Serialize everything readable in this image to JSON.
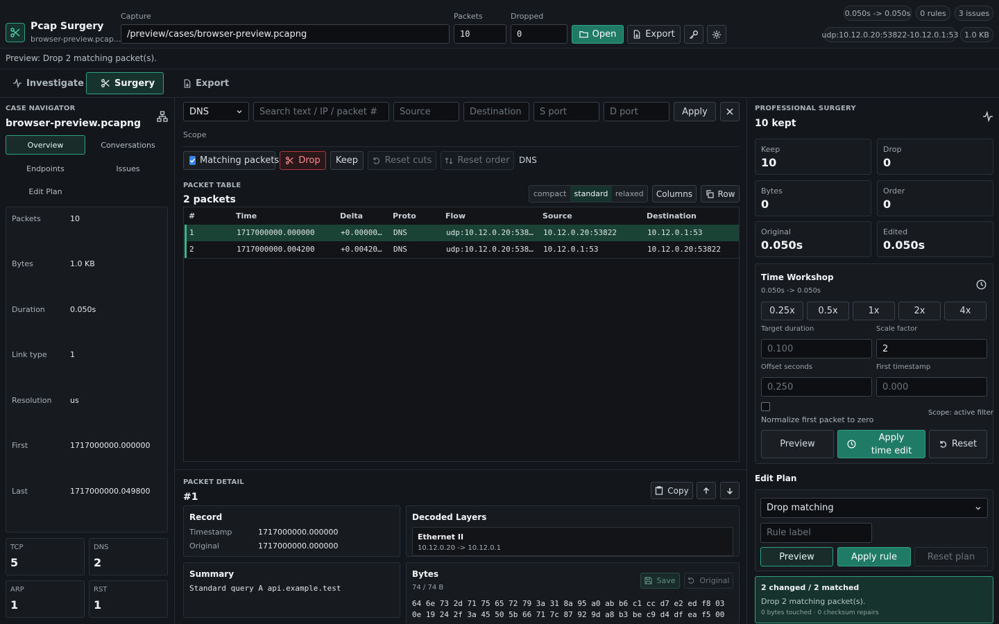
{
  "app": {
    "title": "Pcap Surgery",
    "subtitle": "browser-preview.pcap..."
  },
  "capture": {
    "label": "Capture",
    "path": "/preview/cases/browser-preview.pcapng"
  },
  "packets": {
    "label": "Packets",
    "value": "10"
  },
  "dropped": {
    "label": "Dropped",
    "value": "0"
  },
  "toolbar": {
    "open": "Open",
    "export": "Export"
  },
  "badges": {
    "duration": "0.050s -> 0.050s",
    "rules": "0 rules",
    "issues": "3 issues",
    "flow": "udp:10.12.0.20:53822-10.12.0.1:53",
    "size": "1.0 KB"
  },
  "status_line": "Preview: Drop 2 matching packet(s).",
  "tabs": [
    {
      "label": "Investigate"
    },
    {
      "label": "Surgery"
    },
    {
      "label": "Export"
    }
  ],
  "navigator": {
    "section": "CASE NAVIGATOR",
    "file": "browser-preview.pcapng",
    "nav": [
      "Overview",
      "Conversations",
      "Endpoints",
      "Issues",
      "Edit Plan"
    ],
    "stats": [
      {
        "k": "Packets",
        "v": "10"
      },
      {
        "k": "Bytes",
        "v": "1.0 KB"
      },
      {
        "k": "Duration",
        "v": "0.050s"
      },
      {
        "k": "Link type",
        "v": "1"
      },
      {
        "k": "Resolution",
        "v": "us"
      },
      {
        "k": "First",
        "v": "1717000000.000000"
      },
      {
        "k": "Last",
        "v": "1717000000.049800"
      }
    ],
    "protos": [
      {
        "k": "TCP",
        "v": "5"
      },
      {
        "k": "DNS",
        "v": "2"
      },
      {
        "k": "ARP",
        "v": "1"
      },
      {
        "k": "RST",
        "v": "1"
      }
    ]
  },
  "filter": {
    "proto": "DNS",
    "search_ph": "Search text / IP / packet #",
    "source_ph": "Source",
    "dest_ph": "Destination",
    "sport_ph": "S port",
    "dport_ph": "D port",
    "apply": "Apply",
    "scope_label": "Scope",
    "matching": "Matching packets",
    "drop": "Drop",
    "keep": "Keep",
    "reset_cuts": "Reset cuts",
    "reset_order": "Reset order",
    "scope_value": "DNS"
  },
  "table": {
    "section": "PACKET TABLE",
    "title": "2 packets",
    "density": [
      "compact",
      "standard",
      "relaxed"
    ],
    "columns_btn": "Columns",
    "row_btn": "Row",
    "headers": [
      "#",
      "Time",
      "Delta",
      "Proto",
      "Flow",
      "Source",
      "Destination"
    ],
    "rows": [
      [
        "1",
        "1717000000.000000",
        "+0.00000…",
        "DNS",
        "udp:10.12.0.20:538…",
        "10.12.0.20:53822",
        "10.12.0.1:53"
      ],
      [
        "2",
        "1717000000.004200",
        "+0.00420…",
        "DNS",
        "udp:10.12.0.20:538…",
        "10.12.0.1:53",
        "10.12.0.20:53822"
      ]
    ]
  },
  "detail": {
    "section": "PACKET DETAIL",
    "title": "#1",
    "copy": "Copy",
    "record_title": "Record",
    "timestamp_k": "Timestamp",
    "timestamp_v": "1717000000.000000",
    "original_k": "Original",
    "original_v": "1717000000.000000",
    "layers_title": "Decoded Layers",
    "layer_name": "Ethernet II",
    "layer_sub": "10.12.0.20 -> 10.12.0.1",
    "summary_title": "Summary",
    "summary_text": "Standard query A api.example.test",
    "bytes_title": "Bytes",
    "bytes_count": "74 / 74 B",
    "save": "Save",
    "original_btn": "Original",
    "hex1": "64 6e 73 2d 71 75 65 72 79 3a 31 8a 95 a0 ab b6 c1 cc d7 e2 ed f8 03",
    "hex2": "0e 19 24 2f 3a 45 50 5b 66 71 7c 87 92 9d a8 b3 be c9 d4 df ea f5 00"
  },
  "surgery": {
    "section": "PROFESSIONAL SURGERY",
    "title": "10 kept",
    "stats": [
      {
        "k": "Keep",
        "v": "10"
      },
      {
        "k": "Drop",
        "v": "0"
      },
      {
        "k": "Bytes",
        "v": "0"
      },
      {
        "k": "Order",
        "v": "0"
      },
      {
        "k": "Original",
        "v": "0.050s"
      },
      {
        "k": "Edited",
        "v": "0.050s"
      }
    ],
    "time_title": "Time Workshop",
    "time_sub": "0.050s -> 0.050s",
    "speeds": [
      "0.25x",
      "0.5x",
      "1x",
      "2x",
      "4x"
    ],
    "target_label": "Target duration",
    "target_ph": "0.100",
    "scale_label": "Scale factor",
    "scale_value": "2",
    "offset_label": "Offset seconds",
    "offset_ph": "0.250",
    "first_label": "First timestamp",
    "first_ph": "0.000",
    "scope_note": "Scope: active filter",
    "normalize": "Normalize first packet to zero",
    "preview": "Preview",
    "apply_time": "Apply time edit",
    "reset": "Reset",
    "plan_title": "Edit Plan",
    "plan_select": "Drop matching",
    "rule_ph": "Rule label",
    "plan_preview": "Preview",
    "apply_rule": "Apply rule",
    "reset_plan": "Reset plan",
    "result_title": "2 changed / 2 matched",
    "result_text": "Drop 2 matching packet(s).",
    "result_sub": "0 bytes touched · 0 checksum repairs"
  }
}
